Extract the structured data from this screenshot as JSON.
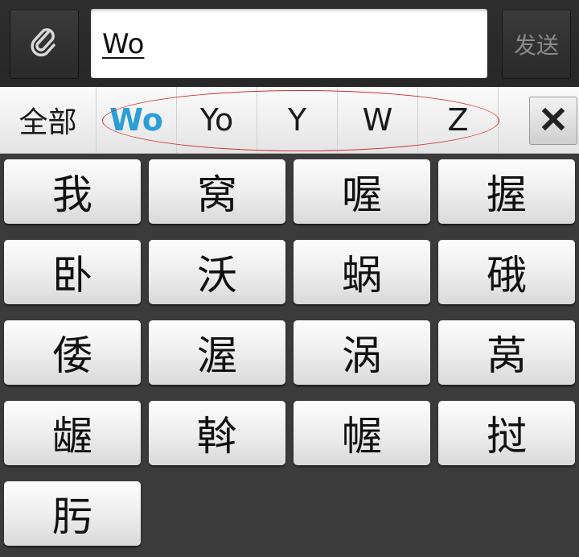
{
  "compose": {
    "input_value": "Wo",
    "send_label": "发送"
  },
  "candidates": {
    "all_label": "全部",
    "items": [
      "Wo",
      "Yo",
      "Y",
      "W",
      "Z",
      ""
    ]
  },
  "characters": [
    "我",
    "窝",
    "喔",
    "握",
    "卧",
    "沃",
    "蜗",
    "硪",
    "倭",
    "渥",
    "涡",
    "莴",
    "龌",
    "斡",
    "幄",
    "挝",
    "肟"
  ]
}
